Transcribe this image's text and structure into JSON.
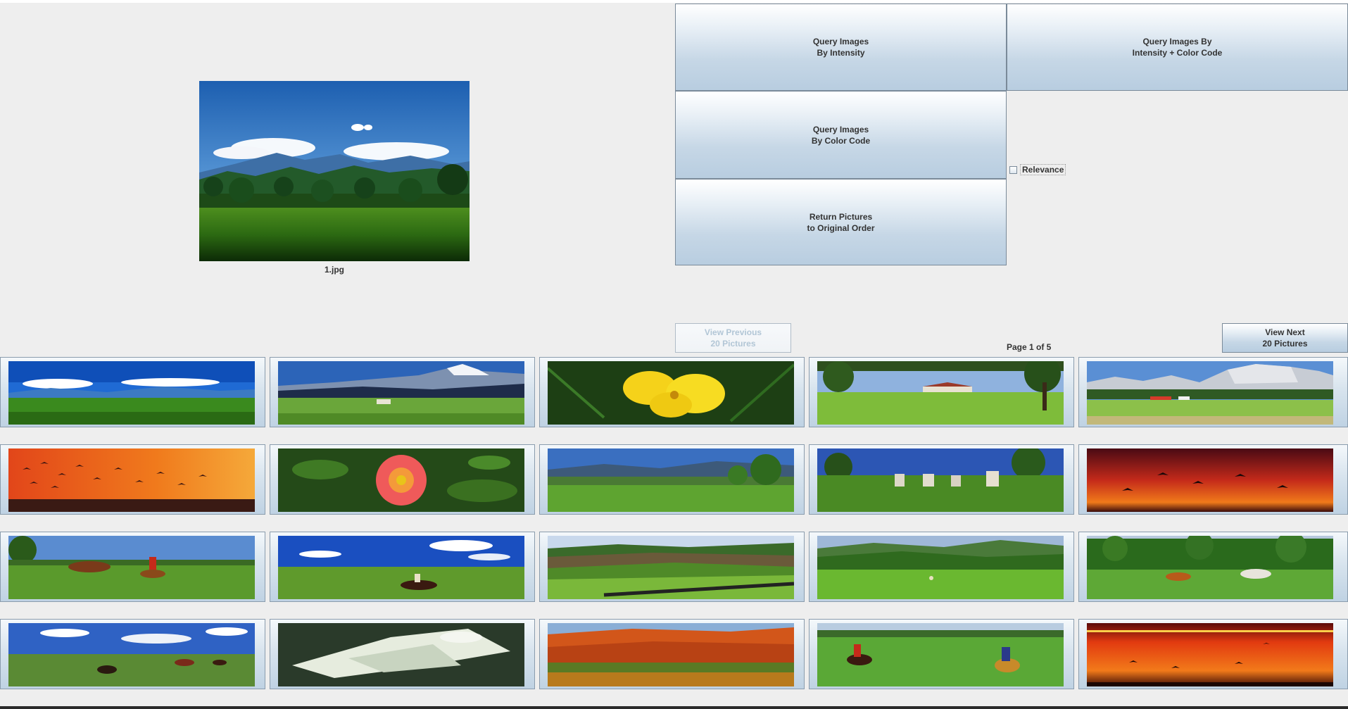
{
  "preview": {
    "filename": "1.jpg"
  },
  "buttons": {
    "query_intensity": [
      "Query Images",
      "By Intensity"
    ],
    "query_combined": [
      "Query Images By",
      "Intensity + Color Code"
    ],
    "query_color": [
      "Query Images",
      "By Color Code"
    ],
    "return_order": [
      "Return Pictures",
      "to Original Order"
    ],
    "view_previous": [
      "View Previous",
      "20 Pictures"
    ],
    "view_next": [
      "View Next",
      "20 Pictures"
    ]
  },
  "relevance": {
    "label": "Relevance",
    "checked": false
  },
  "pagination": {
    "label": "Page 1 of 5",
    "current": 1,
    "total": 5
  },
  "thumbnails": [
    {
      "scene": "blue sky with white clouds over green meadow"
    },
    {
      "scene": "snowy mountains over green pasture with farmhouse"
    },
    {
      "scene": "yellow flowers on dark green foliage"
    },
    {
      "scene": "green park with trees and farmhouse"
    },
    {
      "scene": "rocky mountain cliffs above village and meadow"
    },
    {
      "scene": "flock of birds against orange sunset sky"
    },
    {
      "scene": "pink flower among green leaves"
    },
    {
      "scene": "green hills with palm trees under blue sky"
    },
    {
      "scene": "white stones on green field"
    },
    {
      "scene": "birds flying in red sunset"
    },
    {
      "scene": "horses and rider on green meadow"
    },
    {
      "scene": "horse rider on open grassland under blue sky"
    },
    {
      "scene": "rolling green and brown farm fields"
    },
    {
      "scene": "green valley with forested hills"
    },
    {
      "scene": "horses running in green pasture by forest"
    },
    {
      "scene": "riders and horses on open plain under blue sky"
    },
    {
      "scene": "white lily flower close-up"
    },
    {
      "scene": "red and orange autumn hillside"
    },
    {
      "scene": "riders with horses in green field"
    },
    {
      "scene": "birds over ocean at orange sunset"
    }
  ],
  "colors": {
    "background": "#eeeeee",
    "button_top": "#ffffff",
    "button_bottom": "#b8cde0",
    "button_border": "#7a8a99",
    "disabled_text": "#b2c6d6"
  }
}
